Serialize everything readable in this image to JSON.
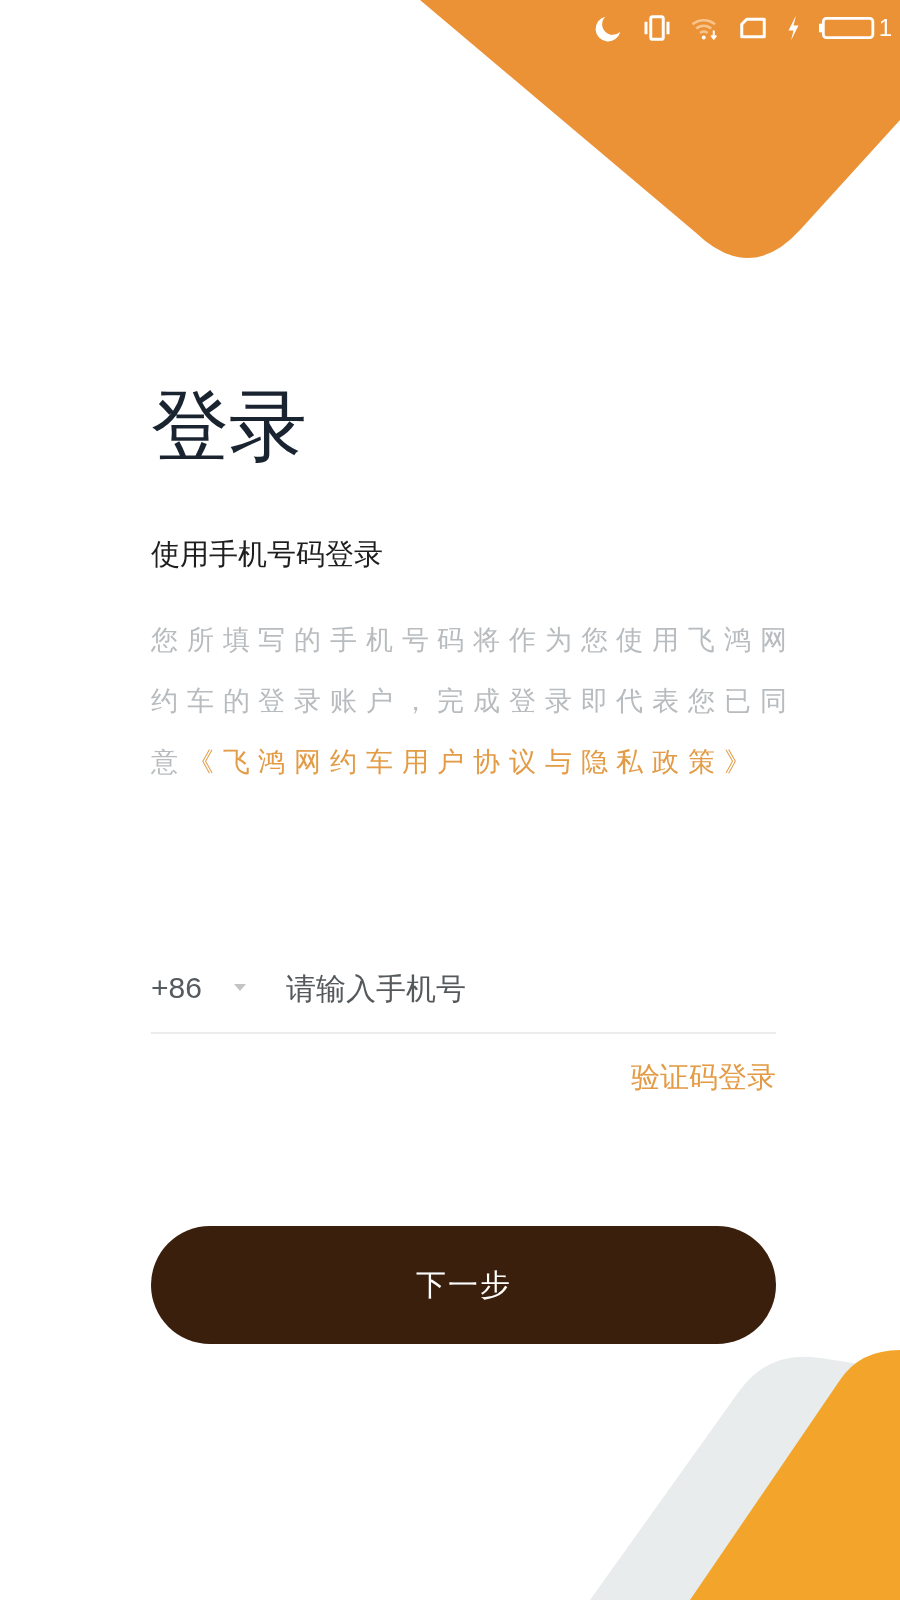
{
  "status_bar": {
    "battery_text": "1"
  },
  "title": "登录",
  "subtitle": "使用手机号码登录",
  "agreement": {
    "text": "您所填写的手机号码将作为您使用飞鸿网约车的登录账户，完成登录即代表您已同意",
    "link": "《飞鸿网约车用户协议与隐私政策》"
  },
  "phone": {
    "country_code": "+86",
    "placeholder": "请输入手机号"
  },
  "alt_login": "验证码登录",
  "next_button": "下一步"
}
